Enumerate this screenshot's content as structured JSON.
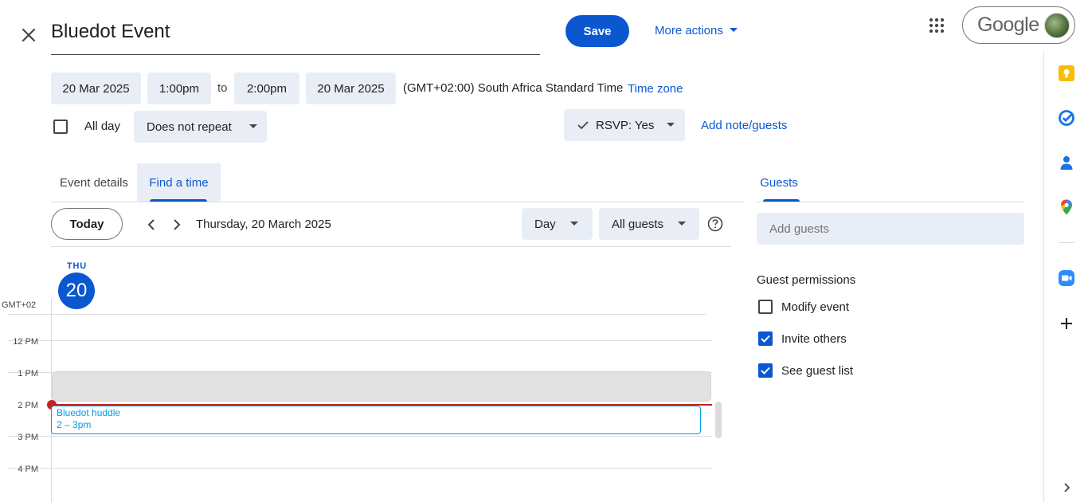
{
  "header": {
    "title": "Bluedot Event",
    "save_label": "Save",
    "more_actions_label": "More actions",
    "google_label": "Google"
  },
  "datetime": {
    "start_date": "20 Mar 2025",
    "start_time": "1:00pm",
    "to_label": "to",
    "end_time": "2:00pm",
    "end_date": "20 Mar 2025",
    "timezone": "(GMT+02:00) South Africa Standard Time",
    "timezone_link": "Time zone"
  },
  "options": {
    "all_day_label": "All day",
    "all_day_checked": false,
    "repeat_label": "Does not repeat",
    "rsvp_label": "RSVP: Yes",
    "add_note_label": "Add note/guests"
  },
  "tabs": {
    "event_details": "Event details",
    "find_a_time": "Find a time",
    "active": "find_a_time"
  },
  "toolbar": {
    "today_label": "Today",
    "date_heading": "Thursday, 20 March 2025",
    "view_label": "Day",
    "guest_filter_label": "All guests"
  },
  "calendar": {
    "day_abbr": "THU",
    "day_number": "20",
    "timezone_label": "GMT+02",
    "hours": [
      {
        "label": "12 PM"
      },
      {
        "label": "1 PM"
      },
      {
        "label": "2 PM"
      },
      {
        "label": "3 PM"
      },
      {
        "label": "4 PM"
      }
    ],
    "event": {
      "title": "Bluedot huddle",
      "time": "2 – 3pm",
      "color": "#039be5"
    }
  },
  "guests": {
    "tab_label": "Guests",
    "add_placeholder": "Add guests",
    "permissions_title": "Guest permissions",
    "permissions": [
      {
        "label": "Modify event",
        "checked": false
      },
      {
        "label": "Invite others",
        "checked": true
      },
      {
        "label": "See guest list",
        "checked": true
      }
    ]
  },
  "side_panel": {
    "icons": [
      "keep-icon",
      "tasks-icon",
      "contacts-icon",
      "maps-icon",
      "zoom-icon",
      "add-icon"
    ]
  },
  "colors": {
    "primary": "#0b57d0",
    "chip_bg": "#e9eef6",
    "now_line": "#c5221f"
  }
}
